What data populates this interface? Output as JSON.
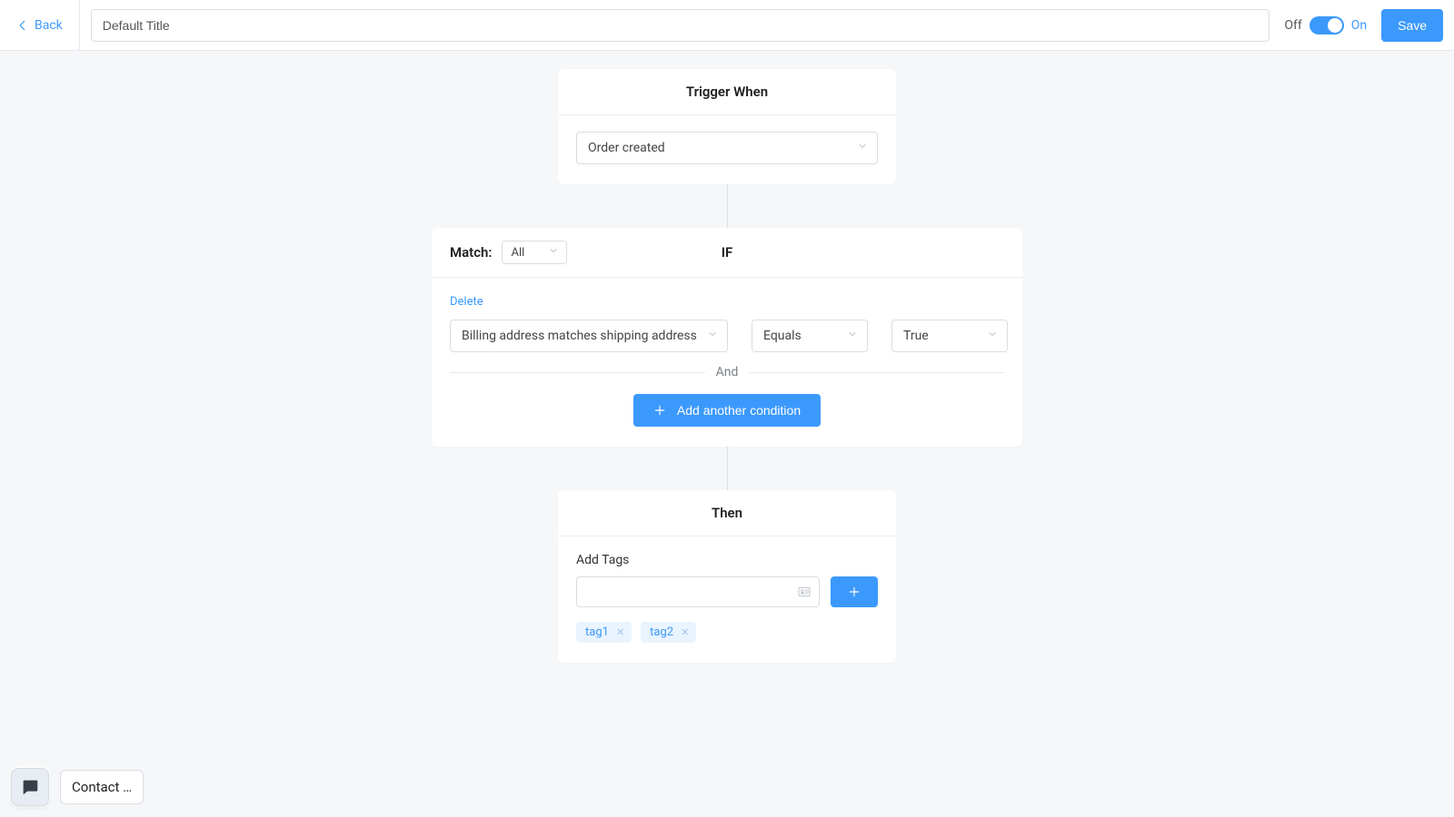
{
  "header": {
    "back_label": "Back",
    "title_value": "Default Title",
    "off_label": "Off",
    "on_label": "On",
    "save_label": "Save"
  },
  "trigger": {
    "heading": "Trigger When",
    "selected": "Order created"
  },
  "conditions": {
    "match_label": "Match:",
    "match_value": "All",
    "if_label": "IF",
    "delete_label": "Delete",
    "rows": [
      {
        "field": "Billing address matches shipping address",
        "op": "Equals",
        "val": "True"
      }
    ],
    "joiner": "And",
    "add_label": "Add another condition"
  },
  "then": {
    "heading": "Then",
    "section_label": "Add Tags",
    "tags": [
      "tag1",
      "tag2"
    ]
  },
  "contact": {
    "label": "Contact …"
  }
}
